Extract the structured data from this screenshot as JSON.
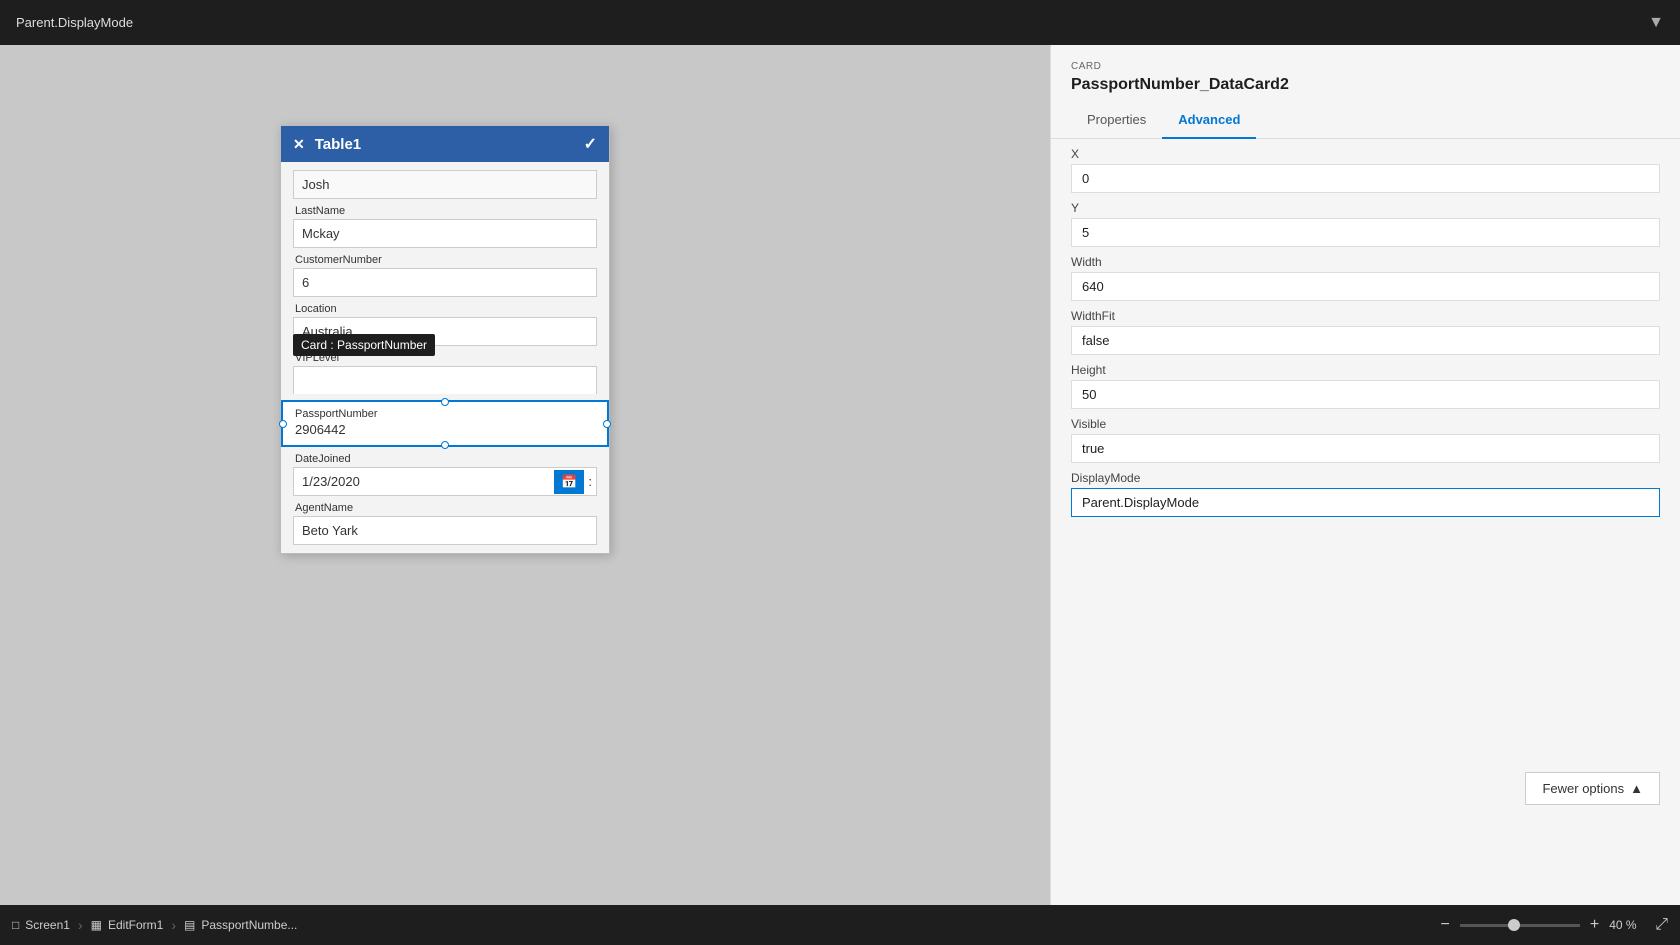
{
  "topbar": {
    "title": "Parent.DisplayMode",
    "chevron": "▼"
  },
  "form": {
    "title": "Table1",
    "fields": [
      {
        "id": "firstname",
        "label": "",
        "value": "Josh",
        "selected": false
      },
      {
        "id": "lastname",
        "label": "LastName",
        "value": "Mckay",
        "selected": false
      },
      {
        "id": "customernumber",
        "label": "CustomerNumber",
        "value": "6",
        "selected": false
      },
      {
        "id": "location",
        "label": "Location",
        "value": "Australia",
        "selected": false
      },
      {
        "id": "viplevel",
        "label": "VIPLevel",
        "value": "",
        "selected": false
      },
      {
        "id": "passportnumber",
        "label": "PassportNumber",
        "value": "2906442",
        "selected": true
      },
      {
        "id": "datejoined",
        "label": "DateJoined",
        "value": "1/23/2020",
        "selected": false
      },
      {
        "id": "agentname",
        "label": "AgentName",
        "value": "Beto Yark",
        "selected": false
      }
    ],
    "tooltip": "Card : PassportNumber"
  },
  "rightpanel": {
    "card_label": "CARD",
    "card_name": "PassportNumber_DataCard2",
    "tabs": [
      {
        "id": "properties",
        "label": "Properties"
      },
      {
        "id": "advanced",
        "label": "Advanced"
      }
    ],
    "active_tab": "Advanced",
    "properties": [
      {
        "id": "x",
        "label": "X",
        "value": "0"
      },
      {
        "id": "y",
        "label": "Y",
        "value": "5"
      },
      {
        "id": "width",
        "label": "Width",
        "value": "640"
      },
      {
        "id": "widthfit",
        "label": "WidthFit",
        "value": "false"
      },
      {
        "id": "height",
        "label": "Height",
        "value": "50"
      },
      {
        "id": "visible",
        "label": "Visible",
        "value": "true"
      },
      {
        "id": "displaymode",
        "label": "DisplayMode",
        "value": "Parent.DisplayMode"
      }
    ],
    "fewer_options_label": "Fewer options",
    "fewer_options_icon": "▲"
  },
  "bottombar": {
    "screen": "Screen1",
    "form": "EditForm1",
    "card": "PassportNumbe...",
    "zoom_minus": "−",
    "zoom_plus": "+",
    "zoom_value": "40 %"
  }
}
